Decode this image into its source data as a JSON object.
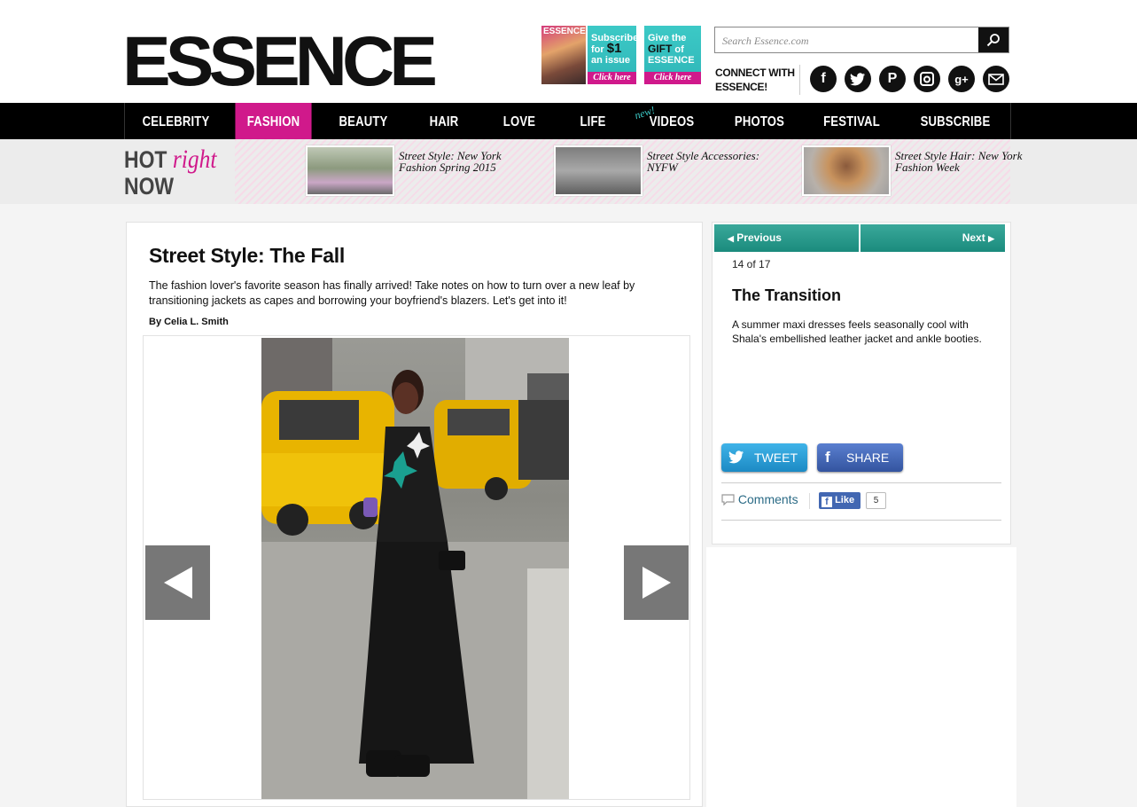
{
  "header": {
    "logo": "ESSENCE",
    "promo_cover_label": "ESSENCE",
    "promo_subscribe": {
      "line1": "Subscribe",
      "line2": "for",
      "price": "$1",
      "line3": "an issue",
      "cta": "Click here"
    },
    "promo_gift": {
      "line1": "Give the",
      "line2": "GIFT",
      "line3": "of",
      "line4": "ESSENCE",
      "cta": "Click here"
    },
    "search_placeholder": "Search Essence.com",
    "connect_line1": "CONNECT WITH",
    "connect_line2": "ESSENCE!",
    "social_icons": [
      "facebook-icon",
      "twitter-icon",
      "pinterest-icon",
      "instagram-icon",
      "google-plus-icon",
      "email-icon"
    ]
  },
  "nav": {
    "items": [
      "CELEBRITY",
      "FASHION",
      "BEAUTY",
      "HAIR",
      "LOVE",
      "LIFE",
      "VIDEOS",
      "PHOTOS",
      "FESTIVAL",
      "SUBSCRIBE"
    ],
    "active": "FASHION",
    "new_tag": "new!"
  },
  "hot": {
    "title_hot": "HOT",
    "title_right": "right",
    "title_now": "NOW",
    "items": [
      {
        "caption": "Street Style: New York Fashion Spring 2015"
      },
      {
        "caption": "Street Style Accessories: NYFW"
      },
      {
        "caption": "Street Style Hair: New York Fashion Week"
      }
    ]
  },
  "article": {
    "title": "Street Style: The Fall",
    "dek": "The fashion lover's favorite season has finally arrived! Take notes on how to turn over a new leaf by transitioning jackets as capes and borrowing your boyfriend's blazers. Let's get into it!",
    "byline": "By Celia L. Smith"
  },
  "slide": {
    "prev_label": "Previous",
    "next_label": "Next",
    "counter": "14 of 17",
    "title": "The Transition",
    "description": "A summer maxi dresses feels seasonally cool with Shala's embellished leather jacket and ankle booties.",
    "tweet_label": "TWEET",
    "share_label": "SHARE",
    "comments_label": "Comments",
    "like_label": "Like",
    "like_count": "5"
  },
  "colors": {
    "brand_pink": "#d0198b",
    "teal": "#1b8b7d",
    "nav_bg": "#000000"
  }
}
